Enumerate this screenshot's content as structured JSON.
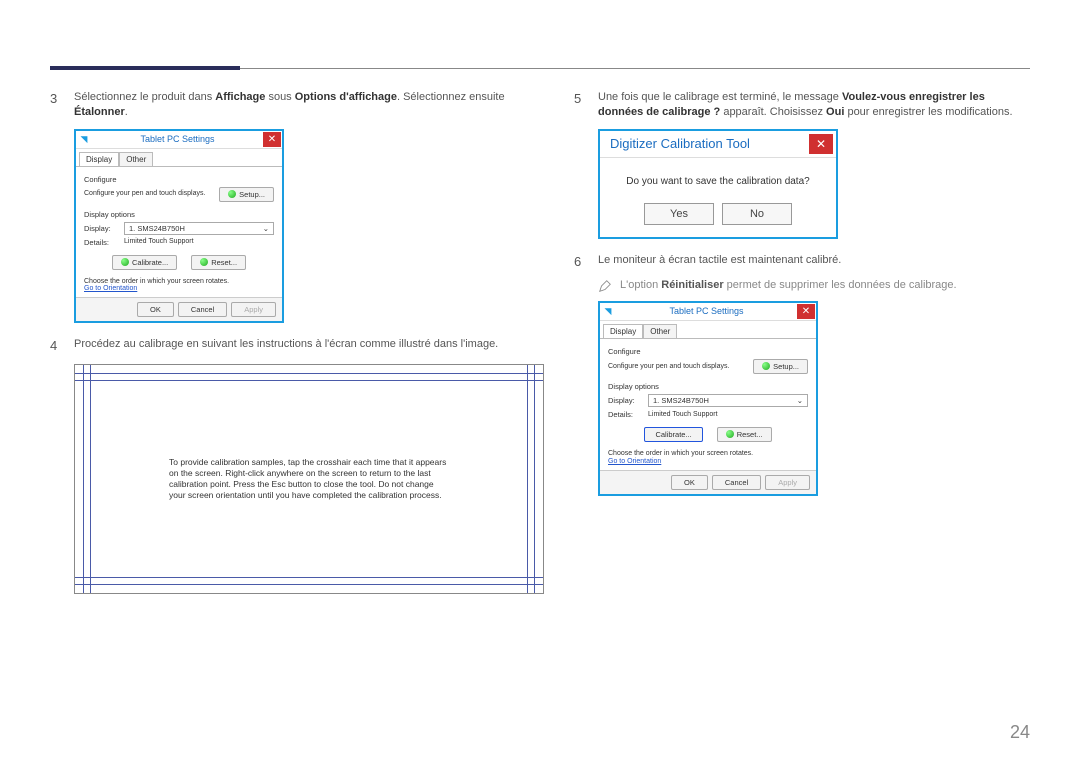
{
  "page_number": "24",
  "left": {
    "step3": {
      "num": "3",
      "prefix": "Sélectionnez le produit dans ",
      "b1": "Affichage",
      "mid": " sous ",
      "b2": "Options d'affichage",
      "mid2": ". Sélectionnez ensuite ",
      "b3": "Étalonner",
      "suffix": "."
    },
    "dialog1": {
      "title": "Tablet PC Settings",
      "tab_display": "Display",
      "tab_other": "Other",
      "configure_label": "Configure",
      "configure_text": "Configure your pen and touch displays.",
      "setup_btn": "Setup...",
      "display_options": "Display options",
      "display_label": "Display:",
      "display_value": "1. SMS24B750H",
      "details_label": "Details:",
      "details_value": "Limited Touch Support",
      "calibrate_btn": "Calibrate...",
      "reset_btn": "Reset...",
      "order_text": "Choose the order in which your screen rotates.",
      "orientation_link": "Go to Orientation",
      "ok": "OK",
      "cancel": "Cancel",
      "apply": "Apply"
    },
    "step4": {
      "num": "4",
      "text": "Procédez au calibrage en suivant les instructions à l'écran comme illustré dans l'image."
    },
    "calib_text": "To provide calibration samples, tap the crosshair each time that it appears on the screen.\nRight-click anywhere on the screen to return to the last calibration point. Press the Esc button to close the tool. Do not change your screen orientation until you have completed the calibration process."
  },
  "right": {
    "step5": {
      "num": "5",
      "prefix": "Une fois que le calibrage est terminé, le message ",
      "b1": "Voulez-vous enregistrer les données de calibrage ?",
      "mid": " apparaît. Choisissez ",
      "b2": "Oui",
      "suffix": " pour enregistrer les modifications."
    },
    "dig": {
      "title": "Digitizer Calibration Tool",
      "question": "Do you want to save the calibration data?",
      "yes": "Yes",
      "no": "No"
    },
    "step6": {
      "num": "6",
      "text": "Le moniteur à écran tactile est maintenant calibré."
    },
    "note": {
      "prefix": "L'option ",
      "b1": "Réinitialiser",
      "suffix": " permet de supprimer les données de calibrage."
    },
    "dialog2": {
      "title": "Tablet PC Settings",
      "tab_display": "Display",
      "tab_other": "Other",
      "configure_label": "Configure",
      "configure_text": "Configure your pen and touch displays.",
      "setup_btn": "Setup...",
      "display_options": "Display options",
      "display_label": "Display:",
      "display_value": "1. SMS24B750H",
      "details_label": "Details:",
      "details_value": "Limited Touch Support",
      "calibrate_btn": "Calibrate...",
      "reset_btn": "Reset...",
      "order_text": "Choose the order in which your screen rotates.",
      "orientation_link": "Go to Orientation",
      "ok": "OK",
      "cancel": "Cancel",
      "apply": "Apply"
    }
  }
}
